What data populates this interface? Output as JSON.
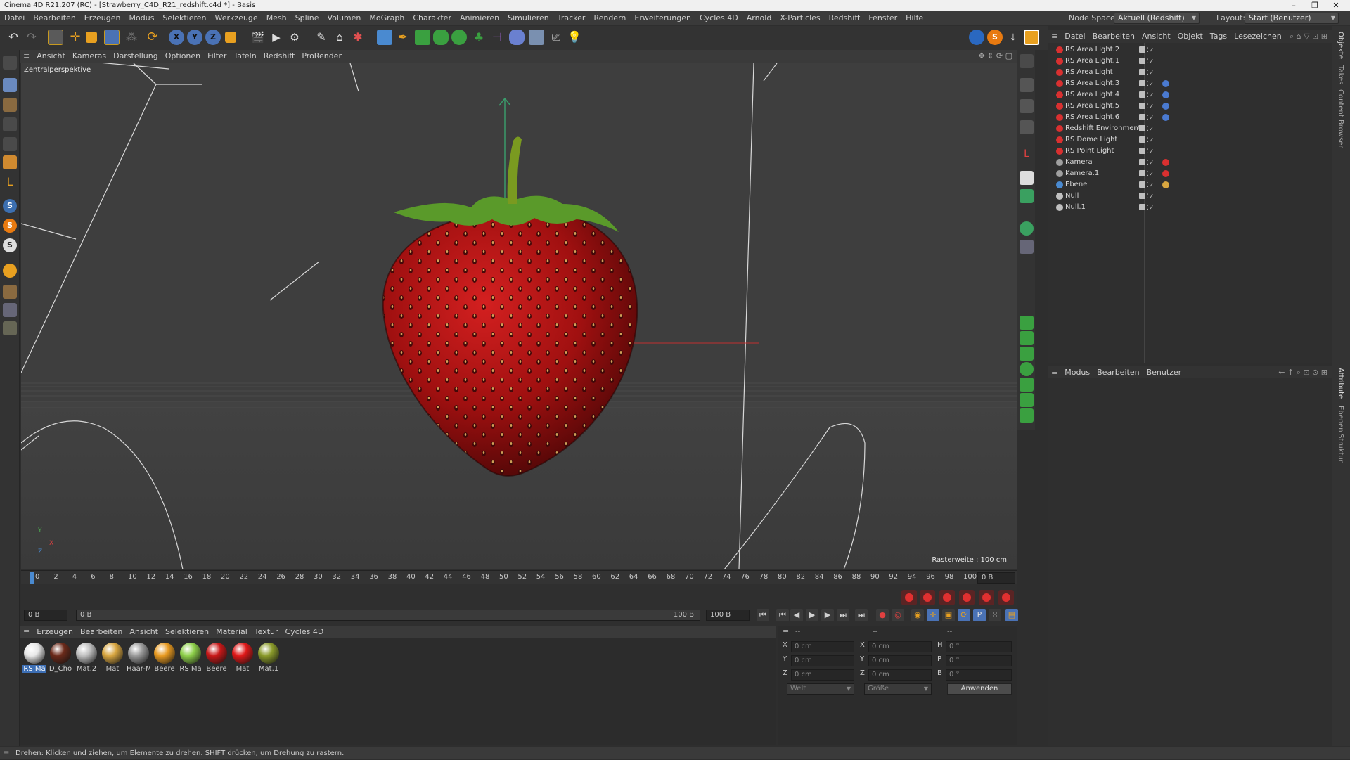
{
  "window": {
    "title": "Cinema 4D R21.207 (RC) - [Strawberry_C4D_R21_redshift.c4d *] - Basis",
    "controls": [
      "–",
      "❐",
      "✕"
    ]
  },
  "menubar": {
    "items": [
      "Datei",
      "Bearbeiten",
      "Erzeugen",
      "Modus",
      "Selektieren",
      "Werkzeuge",
      "Mesh",
      "Spline",
      "Volumen",
      "MoGraph",
      "Charakter",
      "Animieren",
      "Simulieren",
      "Tracker",
      "Rendern",
      "Erweiterungen",
      "Cycles 4D",
      "Arnold",
      "X-Particles",
      "Redshift",
      "Fenster",
      "Hilfe"
    ],
    "node_space_label": "Node Space:",
    "node_space_value": "Aktuell (Redshift)",
    "layout_label": "Layout:",
    "layout_value": "Start (Benutzer)"
  },
  "toolbar": {
    "axis_x": "X",
    "axis_y": "Y",
    "axis_z": "Z"
  },
  "viewport": {
    "menu": [
      "Ansicht",
      "Kameras",
      "Darstellung",
      "Optionen",
      "Filter",
      "Tafeln",
      "Redshift",
      "ProRender"
    ],
    "label": "Zentralperspektive",
    "raster": "Rasterweite : 100 cm",
    "axis_y": "Y",
    "axis_x": "X",
    "axis_z": "Z"
  },
  "timeline": {
    "ticks": [
      "0",
      "2",
      "4",
      "6",
      "8",
      "10",
      "12",
      "14",
      "16",
      "18",
      "20",
      "22",
      "24",
      "26",
      "28",
      "30",
      "32",
      "34",
      "36",
      "38",
      "40",
      "42",
      "44",
      "46",
      "48",
      "50",
      "52",
      "54",
      "56",
      "58",
      "60",
      "62",
      "64",
      "66",
      "68",
      "70",
      "72",
      "74",
      "76",
      "78",
      "80",
      "82",
      "84",
      "86",
      "88",
      "90",
      "92",
      "94",
      "96",
      "98",
      "100"
    ],
    "current_frame": "0 B",
    "start": "0 B",
    "preview_start": "0 B",
    "preview_end": "100 B",
    "end": "100 B"
  },
  "materials": {
    "menu": [
      "Erzeugen",
      "Bearbeiten",
      "Ansicht",
      "Selektieren",
      "Material",
      "Textur",
      "Cycles 4D"
    ],
    "items": [
      {
        "name": "RS Ma",
        "color": "#e8e8e8",
        "selected": true
      },
      {
        "name": "D_Cho",
        "color": "#6b2a1a",
        "selected": false
      },
      {
        "name": "Mat.2",
        "color": "#bfbfbf",
        "selected": false
      },
      {
        "name": "Mat",
        "color": "#d8a640",
        "selected": false
      },
      {
        "name": "Haar-M",
        "color": "#9a9a9a",
        "selected": false
      },
      {
        "name": "Beere",
        "color": "#e89a20",
        "selected": false
      },
      {
        "name": "RS Ma",
        "color": "#8ed04a",
        "selected": false
      },
      {
        "name": "Beere",
        "color": "#c81818",
        "selected": false
      },
      {
        "name": "Mat",
        "color": "#e01818",
        "selected": false
      },
      {
        "name": "Mat.1",
        "color": "#8a9a2a",
        "selected": false
      }
    ]
  },
  "coords": {
    "header": [
      "--",
      "--",
      "--"
    ],
    "rows": [
      {
        "pos_label": "X",
        "pos": "0 cm",
        "size_label": "X",
        "size": "0 cm",
        "rot_label": "H",
        "rot": "0 °"
      },
      {
        "pos_label": "Y",
        "pos": "0 cm",
        "size_label": "Y",
        "size": "0 cm",
        "rot_label": "P",
        "rot": "0 °"
      },
      {
        "pos_label": "Z",
        "pos": "0 cm",
        "size_label": "Z",
        "size": "0 cm",
        "rot_label": "B",
        "rot": "0 °"
      }
    ],
    "mode": "Welt",
    "size_mode": "Größe",
    "apply": "Anwenden"
  },
  "objects": {
    "menu": [
      "Datei",
      "Bearbeiten",
      "Ansicht",
      "Objekt",
      "Tags",
      "Lesezeichen"
    ],
    "items": [
      {
        "name": "RS Area Light.2",
        "icon": "#d93030",
        "tag": ""
      },
      {
        "name": "RS Area Light.1",
        "icon": "#d93030",
        "tag": ""
      },
      {
        "name": "RS Area Light",
        "icon": "#d93030",
        "tag": ""
      },
      {
        "name": "RS Area Light.3",
        "icon": "#d93030",
        "tag": "#4a7ad0"
      },
      {
        "name": "RS Area Light.4",
        "icon": "#d93030",
        "tag": "#4a7ad0"
      },
      {
        "name": "RS Area Light.5",
        "icon": "#d93030",
        "tag": "#4a7ad0"
      },
      {
        "name": "RS Area Light.6",
        "icon": "#d93030",
        "tag": "#4a7ad0"
      },
      {
        "name": "Redshift Environment",
        "icon": "#d93030",
        "tag": ""
      },
      {
        "name": "RS Dome Light",
        "icon": "#d93030",
        "tag": ""
      },
      {
        "name": "RS Point Light",
        "icon": "#d93030",
        "tag": ""
      },
      {
        "name": "Kamera",
        "icon": "#a0a0a0",
        "tag": "#d93030"
      },
      {
        "name": "Kamera.1",
        "icon": "#a0a0a0",
        "tag": "#d93030"
      },
      {
        "name": "Ebene",
        "icon": "#4a8ad0",
        "tag": "#d8a640"
      },
      {
        "name": "Null",
        "icon": "#c0c0c0",
        "tag": ""
      },
      {
        "name": "Null.1",
        "icon": "#c0c0c0",
        "tag": ""
      }
    ]
  },
  "attributes": {
    "menu": [
      "Modus",
      "Bearbeiten",
      "Benutzer"
    ]
  },
  "side_tabs": [
    "Objekte",
    "Takes",
    "Content Browser",
    "Attribute",
    "Ebenen",
    "Struktur"
  ],
  "status": "Drehen: Klicken und ziehen, um Elemente zu drehen. SHIFT drücken, um Drehung zu rastern.",
  "colors": {
    "accent": "#3d6fb5",
    "record": "#e03030"
  }
}
